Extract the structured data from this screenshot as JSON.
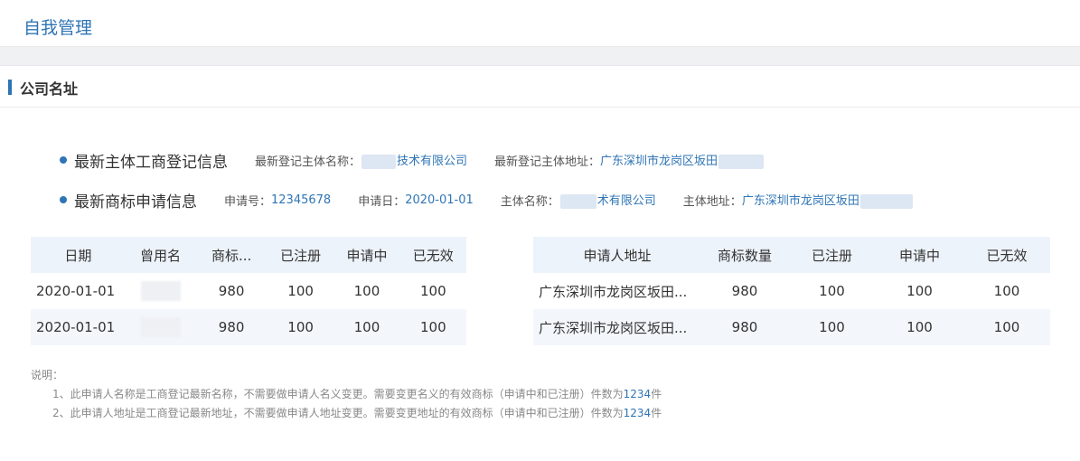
{
  "page": {
    "title": "自我管理"
  },
  "section": {
    "title": "公司名址"
  },
  "business_info": {
    "heading": "最新主体工商登记信息",
    "name_label": "最新登记主体名称：",
    "name_value": "技术有限公司",
    "address_label": "最新登记主体地址：",
    "address_value": "广东深圳市龙岗区坂田"
  },
  "trademark_info": {
    "heading": "最新商标申请信息",
    "appno_label": "申请号：",
    "appno_value": "12345678",
    "date_label": "申请日：",
    "date_value": "2020-01-01",
    "name_label": "主体名称：",
    "name_value": "术有限公司",
    "address_label": "主体地址：",
    "address_value": "广东深圳市龙岗区坂田"
  },
  "name_table": {
    "headers": [
      "日期",
      "曾用名",
      "商标...",
      "已注册",
      "申请中",
      "已无效"
    ],
    "rows": [
      [
        "2020-01-01",
        "",
        "980",
        "100",
        "100",
        "100"
      ],
      [
        "2020-01-01",
        "",
        "980",
        "100",
        "100",
        "100"
      ]
    ]
  },
  "address_table": {
    "headers": [
      "申请人地址",
      "商标数量",
      "已注册",
      "申请中",
      "已无效"
    ],
    "rows": [
      [
        "广东深圳市龙岗区坂田...",
        "980",
        "100",
        "100",
        "100"
      ],
      [
        "广东深圳市龙岗区坂田...",
        "980",
        "100",
        "100",
        "100"
      ]
    ]
  },
  "notes": {
    "title": "说明：",
    "line1_text": "1、此申请人名称是工商登记最新名称，不需要做申请人名义变更。需要变更名义的有效商标（申请中和已注册）件数为",
    "line1_count": "1234",
    "line1_unit": "件",
    "line2_text": "2、此申请人地址是工商登记最新地址，不需要做申请人地址变更。需要变更地址的有效商标（申请中和已注册）件数为",
    "line2_count": "1234",
    "line2_unit": "件"
  }
}
